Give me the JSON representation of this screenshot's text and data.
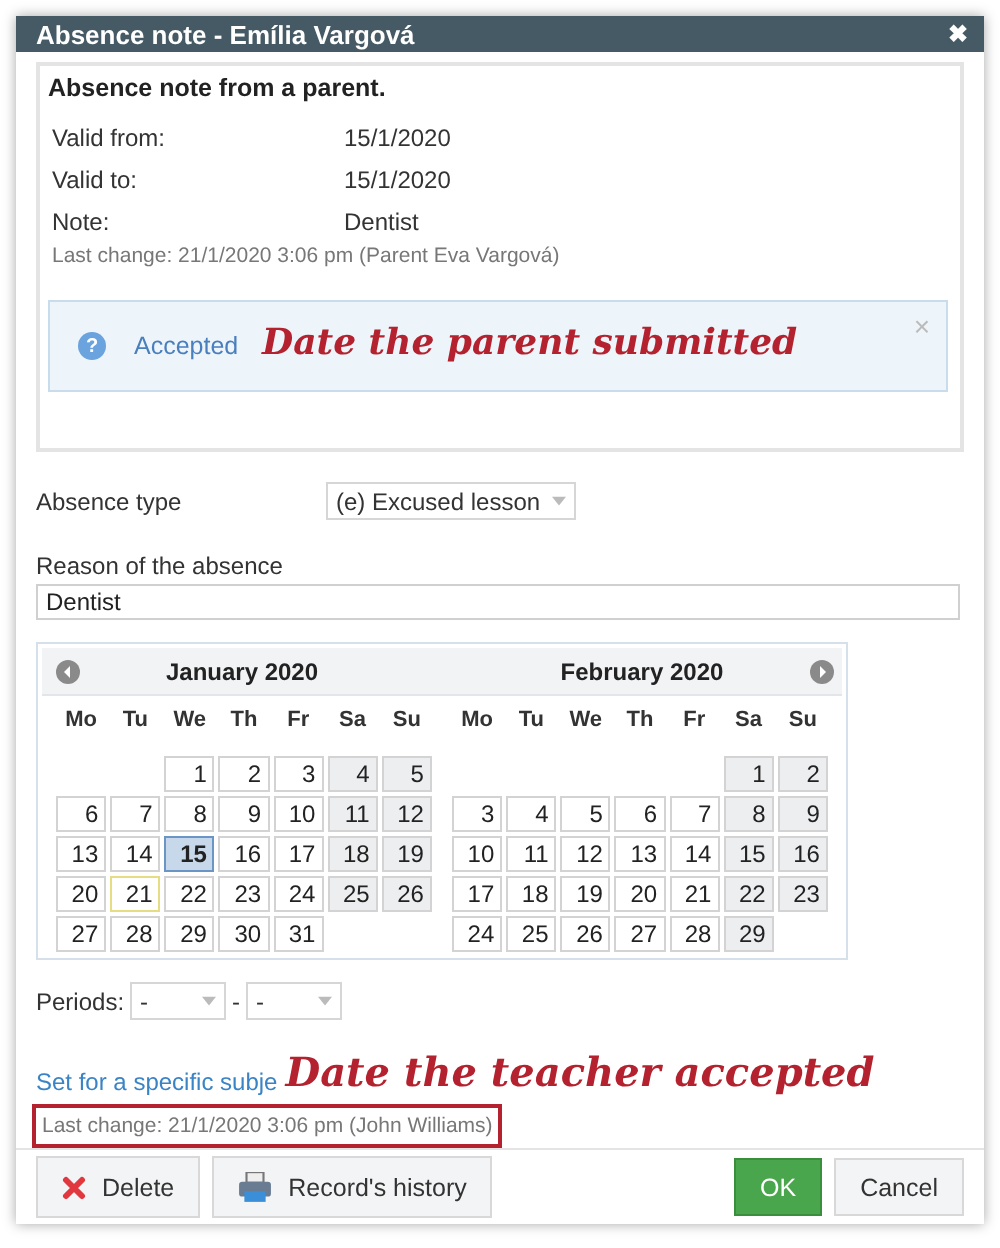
{
  "window": {
    "title": "Absence note - Emília Vargová",
    "close": "✖"
  },
  "parent_note": {
    "heading": "Absence note from a parent.",
    "fields": [
      {
        "label": "Valid from:",
        "value": "15/1/2020"
      },
      {
        "label": "Valid to:",
        "value": "15/1/2020"
      },
      {
        "label": "Note:",
        "value": "Dentist"
      }
    ],
    "last_change": "Last change: 21/1/2020 3:06 pm (Parent Eva Vargová)",
    "alert": {
      "icon": "?",
      "text": "Accepted",
      "close": "×"
    }
  },
  "absence_type": {
    "label": "Absence type",
    "value": "(e) Excused lesson"
  },
  "reason": {
    "label": "Reason of the absence",
    "value": "Dentist"
  },
  "calendar": {
    "months": [
      {
        "title": "January 2020",
        "weekdays": [
          "Mo",
          "Tu",
          "We",
          "Th",
          "Fr",
          "Sa",
          "Su"
        ],
        "weeks": [
          [
            {
              "kind": "blank"
            },
            {
              "kind": "blank"
            },
            {
              "kind": "day",
              "d": "1",
              "selected": false,
              "today": false
            },
            {
              "kind": "day",
              "d": "2",
              "selected": false,
              "today": false
            },
            {
              "kind": "day",
              "d": "3",
              "selected": false,
              "today": false
            },
            {
              "kind": "day",
              "d": "4",
              "selected": false,
              "today": false
            },
            {
              "kind": "day",
              "d": "5",
              "selected": false,
              "today": false
            }
          ],
          [
            {
              "kind": "day",
              "d": "6",
              "selected": false,
              "today": false
            },
            {
              "kind": "day",
              "d": "7",
              "selected": false,
              "today": false
            },
            {
              "kind": "day",
              "d": "8",
              "selected": false,
              "today": false
            },
            {
              "kind": "day",
              "d": "9",
              "selected": false,
              "today": false
            },
            {
              "kind": "day",
              "d": "10",
              "selected": false,
              "today": false
            },
            {
              "kind": "day",
              "d": "11",
              "selected": false,
              "today": false
            },
            {
              "kind": "day",
              "d": "12",
              "selected": false,
              "today": false
            }
          ],
          [
            {
              "kind": "day",
              "d": "13",
              "selected": false,
              "today": false
            },
            {
              "kind": "day",
              "d": "14",
              "selected": false,
              "today": false
            },
            {
              "kind": "day",
              "d": "15",
              "selected": true,
              "today": false
            },
            {
              "kind": "day",
              "d": "16",
              "selected": false,
              "today": false
            },
            {
              "kind": "day",
              "d": "17",
              "selected": false,
              "today": false
            },
            {
              "kind": "day",
              "d": "18",
              "selected": false,
              "today": false
            },
            {
              "kind": "day",
              "d": "19",
              "selected": false,
              "today": false
            }
          ],
          [
            {
              "kind": "day",
              "d": "20",
              "selected": false,
              "today": false
            },
            {
              "kind": "day",
              "d": "21",
              "selected": false,
              "today": true
            },
            {
              "kind": "day",
              "d": "22",
              "selected": false,
              "today": false
            },
            {
              "kind": "day",
              "d": "23",
              "selected": false,
              "today": false
            },
            {
              "kind": "day",
              "d": "24",
              "selected": false,
              "today": false
            },
            {
              "kind": "day",
              "d": "25",
              "selected": false,
              "today": false
            },
            {
              "kind": "day",
              "d": "26",
              "selected": false,
              "today": false
            }
          ],
          [
            {
              "kind": "day",
              "d": "27",
              "selected": false,
              "today": false
            },
            {
              "kind": "day",
              "d": "28",
              "selected": false,
              "today": false
            },
            {
              "kind": "day",
              "d": "29",
              "selected": false,
              "today": false
            },
            {
              "kind": "day",
              "d": "30",
              "selected": false,
              "today": false
            },
            {
              "kind": "day",
              "d": "31",
              "selected": false,
              "today": false
            },
            {
              "kind": "blank"
            },
            {
              "kind": "blank"
            }
          ]
        ]
      },
      {
        "title": "February 2020",
        "weekdays": [
          "Mo",
          "Tu",
          "We",
          "Th",
          "Fr",
          "Sa",
          "Su"
        ],
        "weeks": [
          [
            {
              "kind": "blank"
            },
            {
              "kind": "blank"
            },
            {
              "kind": "blank"
            },
            {
              "kind": "blank"
            },
            {
              "kind": "blank"
            },
            {
              "kind": "day",
              "d": "1",
              "selected": false,
              "today": false
            },
            {
              "kind": "day",
              "d": "2",
              "selected": false,
              "today": false
            }
          ],
          [
            {
              "kind": "day",
              "d": "3",
              "selected": false,
              "today": false
            },
            {
              "kind": "day",
              "d": "4",
              "selected": false,
              "today": false
            },
            {
              "kind": "day",
              "d": "5",
              "selected": false,
              "today": false
            },
            {
              "kind": "day",
              "d": "6",
              "selected": false,
              "today": false
            },
            {
              "kind": "day",
              "d": "7",
              "selected": false,
              "today": false
            },
            {
              "kind": "day",
              "d": "8",
              "selected": false,
              "today": false
            },
            {
              "kind": "day",
              "d": "9",
              "selected": false,
              "today": false
            }
          ],
          [
            {
              "kind": "day",
              "d": "10",
              "selected": false,
              "today": false
            },
            {
              "kind": "day",
              "d": "11",
              "selected": false,
              "today": false
            },
            {
              "kind": "day",
              "d": "12",
              "selected": false,
              "today": false
            },
            {
              "kind": "day",
              "d": "13",
              "selected": false,
              "today": false
            },
            {
              "kind": "day",
              "d": "14",
              "selected": false,
              "today": false
            },
            {
              "kind": "day",
              "d": "15",
              "selected": false,
              "today": false
            },
            {
              "kind": "day",
              "d": "16",
              "selected": false,
              "today": false
            }
          ],
          [
            {
              "kind": "day",
              "d": "17",
              "selected": false,
              "today": false
            },
            {
              "kind": "day",
              "d": "18",
              "selected": false,
              "today": false
            },
            {
              "kind": "day",
              "d": "19",
              "selected": false,
              "today": false
            },
            {
              "kind": "day",
              "d": "20",
              "selected": false,
              "today": false
            },
            {
              "kind": "day",
              "d": "21",
              "selected": false,
              "today": false
            },
            {
              "kind": "day",
              "d": "22",
              "selected": false,
              "today": false
            },
            {
              "kind": "day",
              "d": "23",
              "selected": false,
              "today": false
            }
          ],
          [
            {
              "kind": "day",
              "d": "24",
              "selected": false,
              "today": false
            },
            {
              "kind": "day",
              "d": "25",
              "selected": false,
              "today": false
            },
            {
              "kind": "day",
              "d": "26",
              "selected": false,
              "today": false
            },
            {
              "kind": "day",
              "d": "27",
              "selected": false,
              "today": false
            },
            {
              "kind": "day",
              "d": "28",
              "selected": false,
              "today": false
            },
            {
              "kind": "day",
              "d": "29",
              "selected": false,
              "today": false
            },
            {
              "kind": "blank"
            }
          ]
        ]
      }
    ]
  },
  "periods": {
    "label": "Periods:",
    "from": "-",
    "separator": "-",
    "to": "-"
  },
  "subject_link": "Set for a specific subje",
  "last_change": "Last change: 21/1/2020 3:06 pm (John Williams)",
  "annotations": [
    {
      "text": "Date the parent submitted"
    },
    {
      "text": "Date the teacher accepted"
    }
  ],
  "buttons": [
    {
      "label": "Delete",
      "kind": "delete"
    },
    {
      "label": "Record's history",
      "kind": "history"
    },
    {
      "label": "OK",
      "kind": "primary"
    },
    {
      "label": "Cancel",
      "kind": "plain"
    }
  ]
}
